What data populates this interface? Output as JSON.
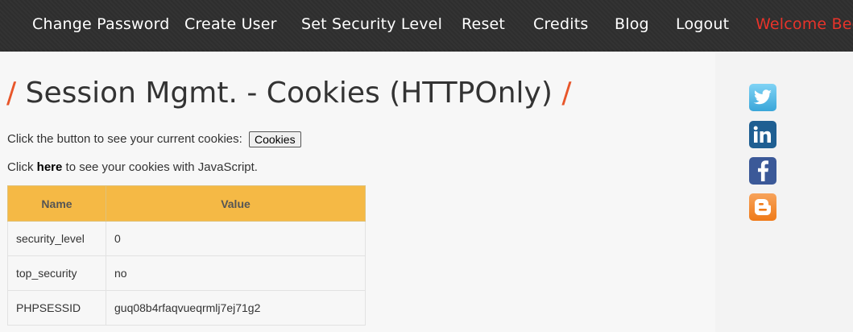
{
  "nav": {
    "items": [
      "Change Password",
      "Create User",
      "Set Security Level",
      "Reset",
      "Credits",
      "Blog",
      "Logout"
    ],
    "welcome": "Welcome Bee"
  },
  "page": {
    "title": "Session Mgmt. - Cookies (HTTPOnly)",
    "slash": "/"
  },
  "intro": {
    "text": "Click the button to see your current cookies:",
    "button_label": "Cookies"
  },
  "js_line": {
    "prefix": "Click",
    "link": "here",
    "suffix": "to see your cookies with JavaScript."
  },
  "table": {
    "headers": [
      "Name",
      "Value"
    ],
    "rows": [
      [
        "security_level",
        "0"
      ],
      [
        "top_security",
        "no"
      ],
      [
        "PHPSESSID",
        "guq08b4rfaqvueqrmlj7ej71g2"
      ]
    ]
  },
  "social": {
    "icons": [
      "twitter-icon",
      "linkedin-icon",
      "facebook-icon",
      "blogger-icon"
    ],
    "colors": {
      "twitter": "#3aa6d9",
      "linkedin": "#1f5f92",
      "facebook": "#3b5998",
      "blogger": "#ef7a18"
    }
  },
  "colors": {
    "nav_bg": "#2f2f2f",
    "accent": "#e8332a",
    "table_header": "#f5b945"
  }
}
